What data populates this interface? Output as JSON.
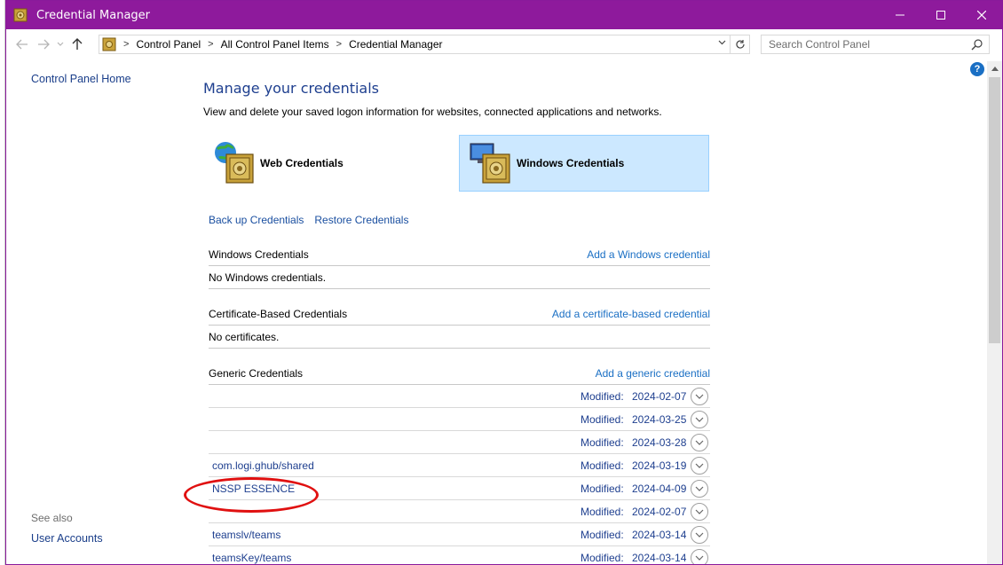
{
  "window": {
    "title": "Credential Manager",
    "accent_color": "#8e1a9c",
    "icon": "credential-manager-icon"
  },
  "caption": {
    "minimize_icon": "minimize-icon",
    "maximize_icon": "maximize-icon",
    "close_icon": "close-icon"
  },
  "address": {
    "breadcrumbs": [
      "Control Panel",
      "All Control Panel Items",
      "Credential Manager"
    ],
    "refresh_icon": "refresh-icon"
  },
  "search": {
    "placeholder": "Search Control Panel",
    "icon": "search-icon"
  },
  "help": {
    "label": "?"
  },
  "left_pane": {
    "home_link": "Control Panel Home",
    "see_also_label": "See also",
    "see_also_links": [
      "User Accounts"
    ]
  },
  "main": {
    "heading": "Manage your credentials",
    "subtitle": "View and delete your saved logon information for websites, connected applications and networks.",
    "vaults": [
      {
        "label": "Web Credentials",
        "selected": false
      },
      {
        "label": "Windows Credentials",
        "selected": true
      }
    ],
    "actions": [
      "Back up Credentials",
      "Restore Credentials"
    ],
    "windows_section": {
      "title": "Windows Credentials",
      "add_link": "Add a Windows credential",
      "empty_text": "No Windows credentials."
    },
    "certificate_section": {
      "title": "Certificate-Based Credentials",
      "add_link": "Add a certificate-based credential",
      "empty_text": "No certificates."
    },
    "generic_section": {
      "title": "Generic Credentials",
      "add_link": "Add a generic credential",
      "modified_label": "Modified:",
      "items": [
        {
          "name": "",
          "date": "2024-02-07"
        },
        {
          "name": "",
          "date": "2024-03-25"
        },
        {
          "name": "",
          "date": "2024-03-28"
        },
        {
          "name": "com.logi.ghub/shared",
          "date": "2024-03-19"
        },
        {
          "name": "NSSP ESSENCE",
          "date": "2024-04-09"
        },
        {
          "name": "",
          "date": "2024-02-07"
        },
        {
          "name": "teamslv/teams",
          "date": "2024-03-14"
        },
        {
          "name": "teamsKey/teams",
          "date": "2024-03-14"
        }
      ]
    }
  },
  "annotation": {
    "color": "#e01010",
    "shape": "ellipse"
  }
}
